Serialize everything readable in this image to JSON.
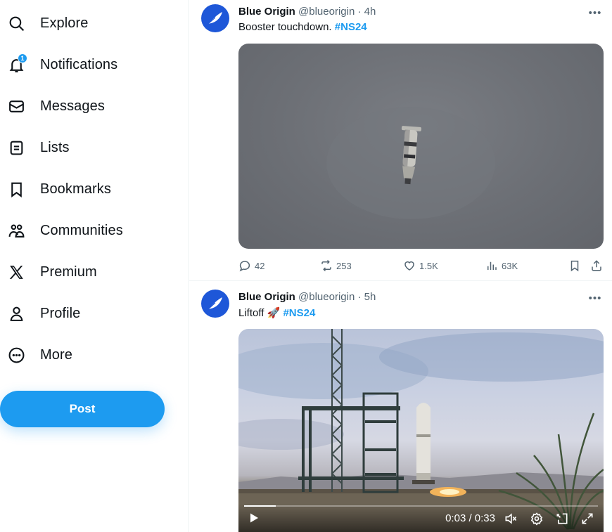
{
  "sidebar": {
    "items": [
      {
        "label": "Explore",
        "icon": "search-icon"
      },
      {
        "label": "Notifications",
        "icon": "bell-icon",
        "badge": "1"
      },
      {
        "label": "Messages",
        "icon": "envelope-icon"
      },
      {
        "label": "Lists",
        "icon": "list-icon"
      },
      {
        "label": "Bookmarks",
        "icon": "bookmark-icon"
      },
      {
        "label": "Communities",
        "icon": "communities-icon"
      },
      {
        "label": "Premium",
        "icon": "x-logo-icon"
      },
      {
        "label": "Profile",
        "icon": "person-icon"
      },
      {
        "label": "More",
        "icon": "more-circle-icon"
      }
    ],
    "post_label": "Post"
  },
  "feed": {
    "tweets": [
      {
        "name": "Blue Origin",
        "handle": "@blueorigin",
        "time": "· 4h",
        "text": "Booster touchdown. ",
        "hashtag": "#NS24",
        "media": "booster-landing-image",
        "stats": {
          "replies": "42",
          "reposts": "253",
          "likes": "1.5K",
          "views": "63K"
        }
      },
      {
        "name": "Blue Origin",
        "handle": "@blueorigin",
        "time": "· 5h",
        "text": "Liftoff ",
        "emoji": "🚀",
        "hashtag": "#NS24",
        "media": "liftoff-video",
        "video": {
          "time": "0:03 / 0:33",
          "progress": 0.09
        }
      }
    ]
  },
  "colors": {
    "accent": "#1d9bf0",
    "text": "#0f1419",
    "muted": "#536471",
    "avatar": "#1e57d8"
  }
}
